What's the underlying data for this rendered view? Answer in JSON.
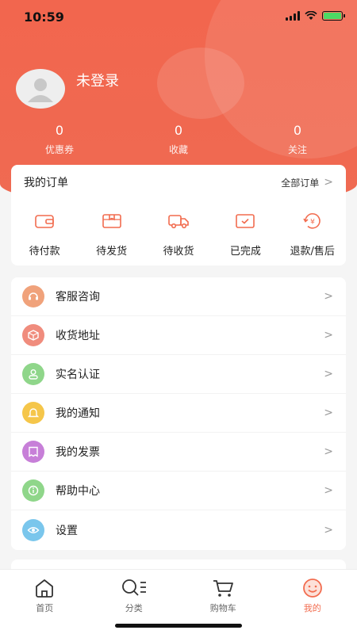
{
  "status_bar": {
    "time": "10:59"
  },
  "profile": {
    "username": "未登录"
  },
  "stats": [
    {
      "value": "0",
      "label": "优惠券"
    },
    {
      "value": "0",
      "label": "收藏"
    },
    {
      "value": "0",
      "label": "关注"
    }
  ],
  "orders": {
    "title": "我的订单",
    "all_label": "全部订单",
    "items": [
      {
        "label": "待付款",
        "icon": "wallet-icon"
      },
      {
        "label": "待发货",
        "icon": "package-icon"
      },
      {
        "label": "待收货",
        "icon": "truck-icon"
      },
      {
        "label": "已完成",
        "icon": "completed-box-icon"
      },
      {
        "label": "退款/售后",
        "icon": "refund-icon"
      }
    ]
  },
  "menu": [
    {
      "label": "客服咨询",
      "icon": "headset-icon",
      "color": "#f0a27b"
    },
    {
      "label": "收货地址",
      "icon": "address-box-icon",
      "color": "#f08c7d"
    },
    {
      "label": "实名认证",
      "icon": "person-icon",
      "color": "#8fd68a"
    },
    {
      "label": "我的通知",
      "icon": "bell-icon",
      "color": "#f5c64a"
    },
    {
      "label": "我的发票",
      "icon": "invoice-icon",
      "color": "#c77fd8"
    },
    {
      "label": "帮助中心",
      "icon": "info-icon",
      "color": "#8fd68a"
    },
    {
      "label": "设置",
      "icon": "eye-settings-icon",
      "color": "#7ac6ec"
    }
  ],
  "tabbar": [
    {
      "label": "首页",
      "icon": "home-icon"
    },
    {
      "label": "分类",
      "icon": "category-search-icon"
    },
    {
      "label": "购物车",
      "icon": "cart-icon"
    },
    {
      "label": "我的",
      "icon": "smiley-icon"
    }
  ],
  "colors": {
    "accent": "#f26c4f"
  }
}
